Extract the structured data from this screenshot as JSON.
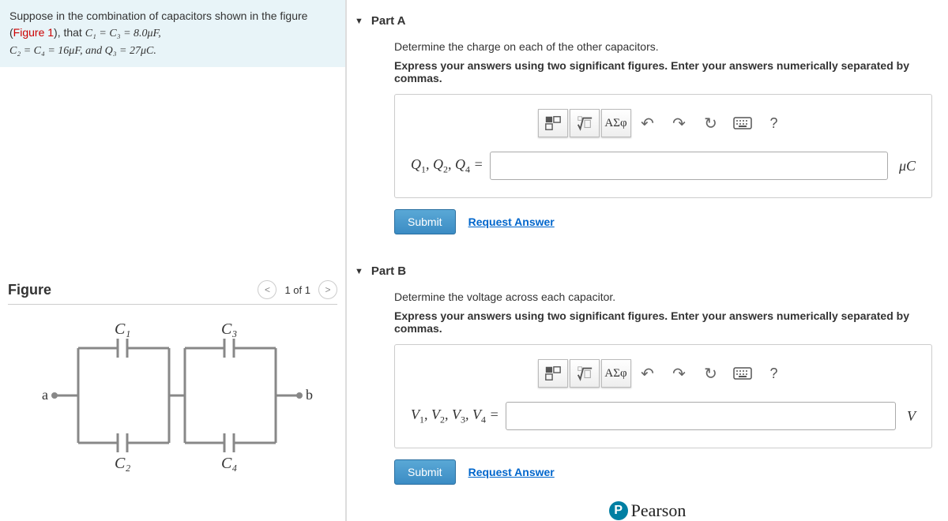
{
  "problem": {
    "intro": "Suppose in the combination of capacitors shown in the figure (",
    "figlink": "Figure 1",
    "after_fig": "), that ",
    "eq1_html": "C₁ = C₃ = 8.0μF,",
    "eq2_html": "C₂ = C₄ = 16μF, and Q₃ = 27μC."
  },
  "figure": {
    "title": "Figure",
    "counter": "1 of 1",
    "labels": {
      "c1": "C₁",
      "c2": "C₂",
      "c3": "C₃",
      "c4": "C₄",
      "a": "a",
      "b": "b"
    }
  },
  "toolbar": {
    "templates": "templates",
    "sqrt": "sqrt",
    "greek": "ΑΣφ",
    "undo": "↶",
    "redo": "↷",
    "reset": "↻",
    "keyboard": "⌨",
    "help": "?"
  },
  "partA": {
    "title": "Part A",
    "desc": "Determine the charge on each of the other capacitors.",
    "instr": "Express your answers using two significant figures. Enter your answers numerically separated by commas.",
    "var": "Q₁, Q₂, Q₄ =",
    "unit": "μC",
    "submit": "Submit",
    "request": "Request Answer"
  },
  "partB": {
    "title": "Part B",
    "desc": "Determine the voltage across each capacitor.",
    "instr": "Express your answers using two significant figures. Enter your answers numerically separated by commas.",
    "var": "V₁, V₂, V₃, V₄ =",
    "unit": "V",
    "submit": "Submit",
    "request": "Request Answer"
  },
  "footer": {
    "brand": "Pearson",
    "p": "P"
  }
}
